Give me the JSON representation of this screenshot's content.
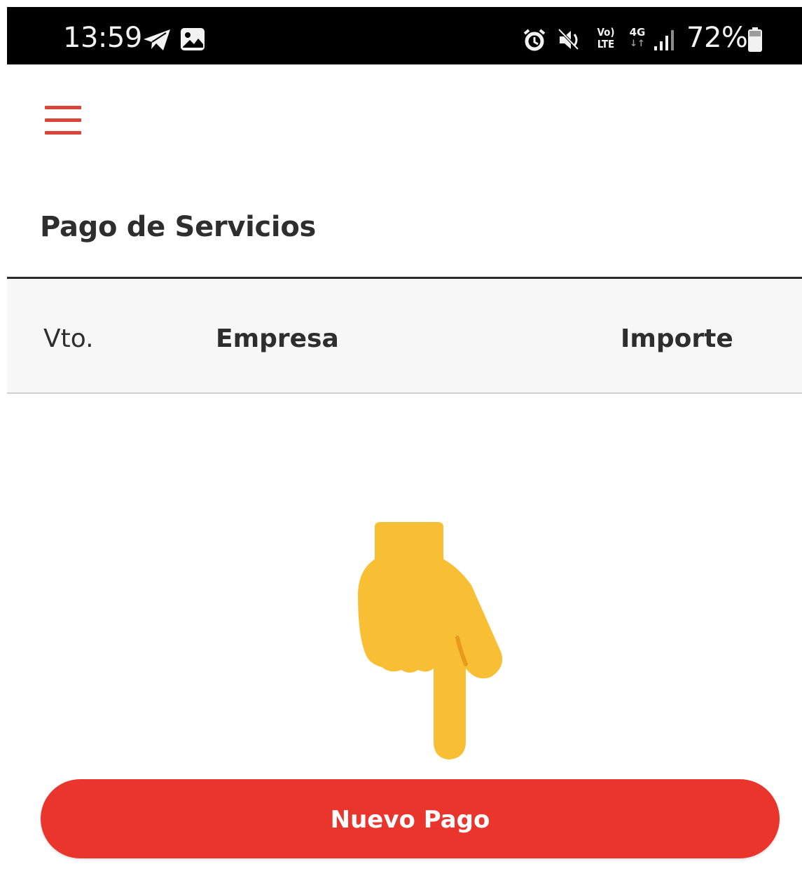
{
  "status_bar": {
    "time": "13:59",
    "battery_percent": "72%",
    "network_text": "4G",
    "volte_text": "Vo)",
    "lte_text": "LTE"
  },
  "header": {
    "menu_icon": "hamburger-menu-icon"
  },
  "page": {
    "title": "Pago de Servicios"
  },
  "table": {
    "columns": [
      "Vto.",
      "Empresa",
      "Importe"
    ]
  },
  "overlay": {
    "icon": "pointing-down-hand-emoji"
  },
  "actions": {
    "new_payment_label": "Nuevo Pago"
  },
  "colors": {
    "accent": "#e9352c",
    "menu_icon": "#d9453a",
    "status_bar": "#000000",
    "header_bg": "#f7f7f7",
    "hand": "#f9bf34"
  }
}
